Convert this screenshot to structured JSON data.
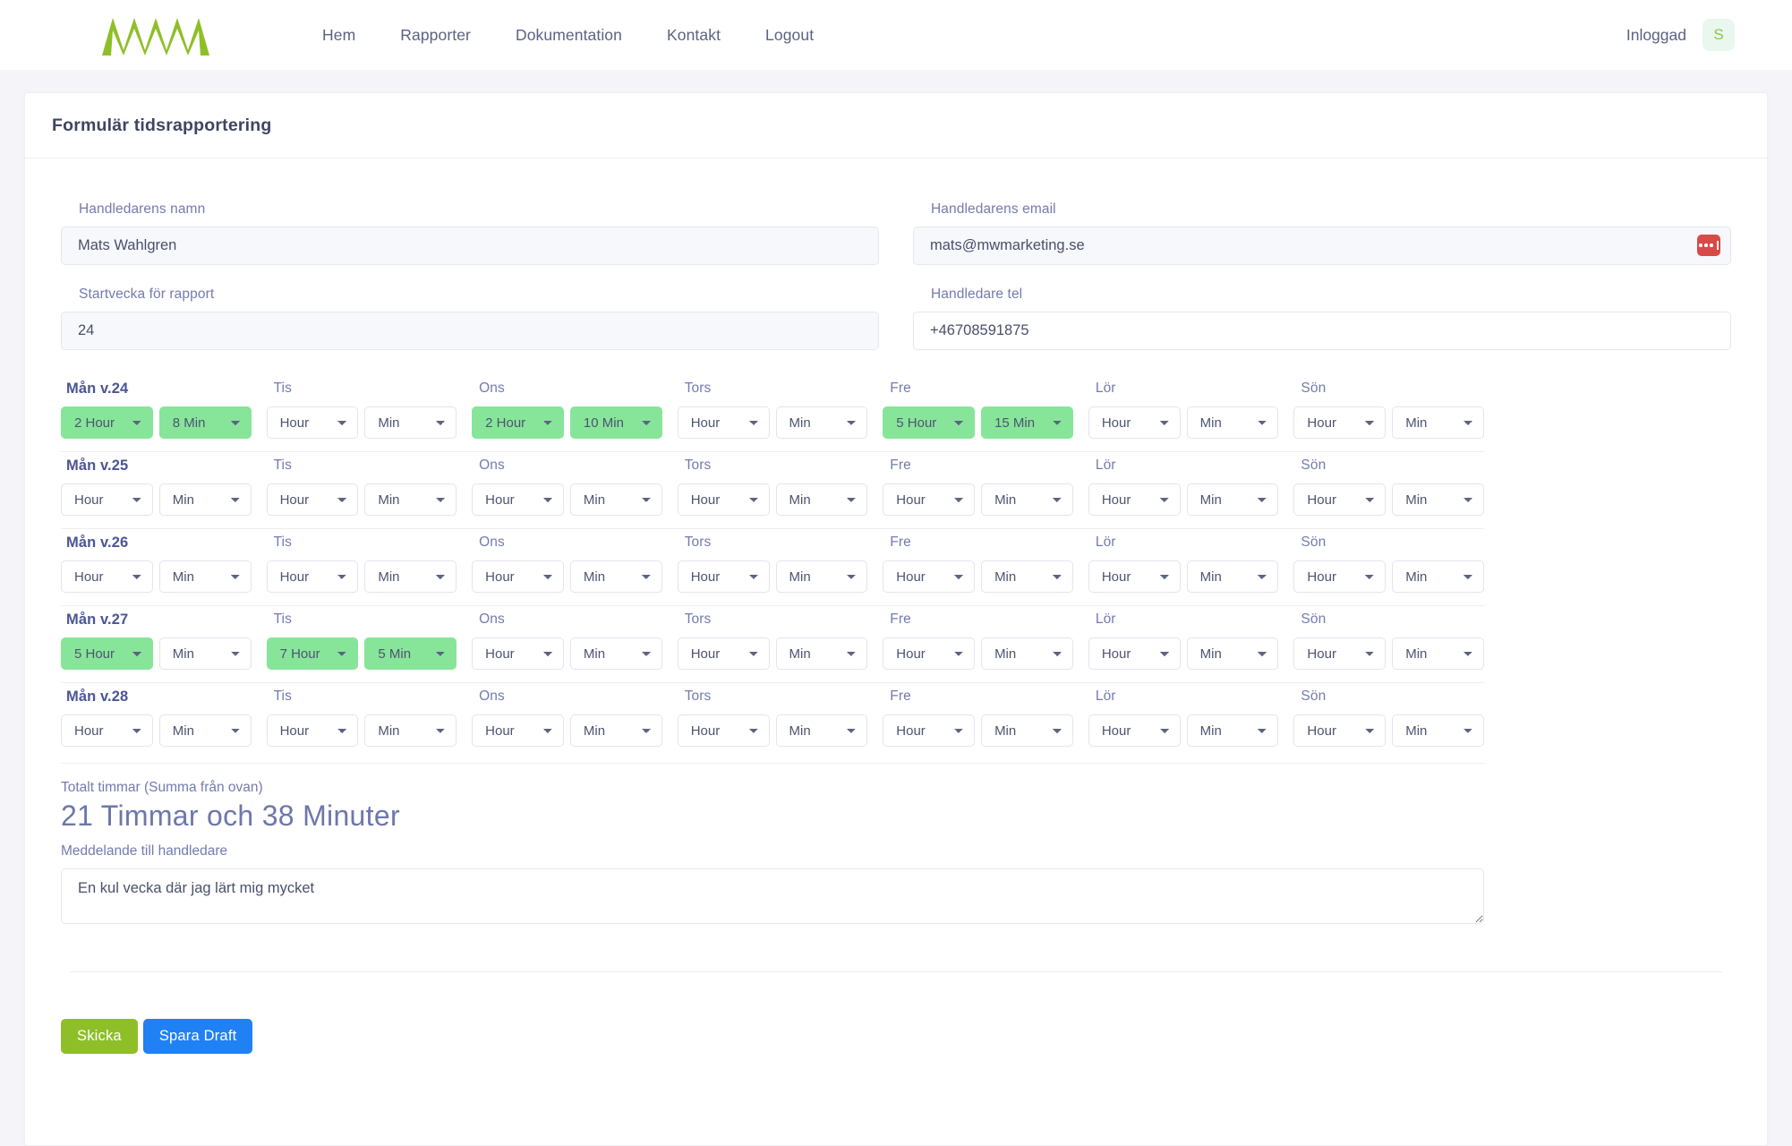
{
  "header": {
    "logo_alt": "MWM logo",
    "logo_color": "#8ebf28",
    "nav": [
      {
        "label": "Hem"
      },
      {
        "label": "Rapporter"
      },
      {
        "label": "Dokumentation"
      },
      {
        "label": "Kontakt"
      },
      {
        "label": "Logout"
      }
    ],
    "status_text": "Inloggad",
    "avatar_initial": "S",
    "avatar_bg": "#e9f7ef",
    "avatar_fg": "#8ec63f"
  },
  "card": {
    "title": "Formulär tidsrapportering"
  },
  "fields": {
    "supervisor_name": {
      "label": "Handledarens namn",
      "value": "Mats Wahlgren",
      "placeholder": "Handledarens namn"
    },
    "supervisor_email": {
      "label": "Handledarens email",
      "value": "mats@mwmarketing.se",
      "placeholder": "Handledarens email"
    },
    "start_week": {
      "label": "Startvecka för rapport",
      "value": "24",
      "placeholder": "Startvecka"
    },
    "supervisor_phone": {
      "label": "Handledare tel",
      "value": "+46708591875",
      "placeholder": "Handledare tel"
    }
  },
  "day_headers": [
    "Mån v.24",
    "Tis",
    "Ons",
    "Tors",
    "Fre",
    "Lör",
    "Sön"
  ],
  "select_placeholders": {
    "hour": "Hour",
    "minute": "Min"
  },
  "selected_color": "#87e59a",
  "weeks": [
    {
      "name": "Mån v.24",
      "day_labels": [
        "Mån v.24",
        "Tis",
        "Ons",
        "Tors",
        "Fre",
        "Lör",
        "Sön"
      ],
      "days": [
        {
          "hour": "2 Hour",
          "min": "8 Min",
          "hour_filled": true,
          "min_filled": true
        },
        {
          "hour": "Hour",
          "min": "Min",
          "hour_filled": false,
          "min_filled": false
        },
        {
          "hour": "2 Hour",
          "min": "10 Min",
          "hour_filled": true,
          "min_filled": true
        },
        {
          "hour": "Hour",
          "min": "Min",
          "hour_filled": false,
          "min_filled": false
        },
        {
          "hour": "5 Hour",
          "min": "15 Min",
          "hour_filled": true,
          "min_filled": true
        },
        {
          "hour": "Hour",
          "min": "Min",
          "hour_filled": false,
          "min_filled": false
        },
        {
          "hour": "Hour",
          "min": "Min",
          "hour_filled": false,
          "min_filled": false
        }
      ]
    },
    {
      "name": "Mån v.25",
      "day_labels": [
        "Mån v.25",
        "Tis",
        "Ons",
        "Tors",
        "Fre",
        "Lör",
        "Sön"
      ],
      "days": [
        {
          "hour": "Hour",
          "min": "Min",
          "hour_filled": false,
          "min_filled": false
        },
        {
          "hour": "Hour",
          "min": "Min",
          "hour_filled": false,
          "min_filled": false
        },
        {
          "hour": "Hour",
          "min": "Min",
          "hour_filled": false,
          "min_filled": false
        },
        {
          "hour": "Hour",
          "min": "Min",
          "hour_filled": false,
          "min_filled": false
        },
        {
          "hour": "Hour",
          "min": "Min",
          "hour_filled": false,
          "min_filled": false
        },
        {
          "hour": "Hour",
          "min": "Min",
          "hour_filled": false,
          "min_filled": false
        },
        {
          "hour": "Hour",
          "min": "Min",
          "hour_filled": false,
          "min_filled": false
        }
      ]
    },
    {
      "name": "Mån v.26",
      "day_labels": [
        "Mån v.26",
        "Tis",
        "Ons",
        "Tors",
        "Fre",
        "Lör",
        "Sön"
      ],
      "days": [
        {
          "hour": "Hour",
          "min": "Min",
          "hour_filled": false,
          "min_filled": false
        },
        {
          "hour": "Hour",
          "min": "Min",
          "hour_filled": false,
          "min_filled": false
        },
        {
          "hour": "Hour",
          "min": "Min",
          "hour_filled": false,
          "min_filled": false
        },
        {
          "hour": "Hour",
          "min": "Min",
          "hour_filled": false,
          "min_filled": false
        },
        {
          "hour": "Hour",
          "min": "Min",
          "hour_filled": false,
          "min_filled": false
        },
        {
          "hour": "Hour",
          "min": "Min",
          "hour_filled": false,
          "min_filled": false
        },
        {
          "hour": "Hour",
          "min": "Min",
          "hour_filled": false,
          "min_filled": false
        }
      ]
    },
    {
      "name": "Mån v.27",
      "day_labels": [
        "Mån v.27",
        "Tis",
        "Ons",
        "Tors",
        "Fre",
        "Lör",
        "Sön"
      ],
      "days": [
        {
          "hour": "5 Hour",
          "min": "Min",
          "hour_filled": true,
          "min_filled": false
        },
        {
          "hour": "7 Hour",
          "min": "5 Min",
          "hour_filled": true,
          "min_filled": true
        },
        {
          "hour": "Hour",
          "min": "Min",
          "hour_filled": false,
          "min_filled": false
        },
        {
          "hour": "Hour",
          "min": "Min",
          "hour_filled": false,
          "min_filled": false
        },
        {
          "hour": "Hour",
          "min": "Min",
          "hour_filled": false,
          "min_filled": false
        },
        {
          "hour": "Hour",
          "min": "Min",
          "hour_filled": false,
          "min_filled": false
        },
        {
          "hour": "Hour",
          "min": "Min",
          "hour_filled": false,
          "min_filled": false
        }
      ]
    },
    {
      "name": "Mån v.28",
      "day_labels": [
        "Mån v.28",
        "Tis",
        "Ons",
        "Tors",
        "Fre",
        "Lör",
        "Sön"
      ],
      "days": [
        {
          "hour": "Hour",
          "min": "Min",
          "hour_filled": false,
          "min_filled": false
        },
        {
          "hour": "Hour",
          "min": "Min",
          "hour_filled": false,
          "min_filled": false
        },
        {
          "hour": "Hour",
          "min": "Min",
          "hour_filled": false,
          "min_filled": false
        },
        {
          "hour": "Hour",
          "min": "Min",
          "hour_filled": false,
          "min_filled": false
        },
        {
          "hour": "Hour",
          "min": "Min",
          "hour_filled": false,
          "min_filled": false
        },
        {
          "hour": "Hour",
          "min": "Min",
          "hour_filled": false,
          "min_filled": false
        },
        {
          "hour": "Hour",
          "min": "Min",
          "hour_filled": false,
          "min_filled": false
        }
      ]
    }
  ],
  "totals": {
    "label": "Totalt timmar (Summa från ovan)",
    "value": "21 Timmar och 38 Minuter"
  },
  "message": {
    "label": "Meddelande till handledare",
    "value": "En kul vecka där jag lärt mig mycket",
    "placeholder": "Meddelande till handledare"
  },
  "actions": {
    "submit_label": "Skicka",
    "submit_color": "#8ebf28",
    "draft_label": "Spara Draft",
    "draft_color": "#2081f5"
  }
}
